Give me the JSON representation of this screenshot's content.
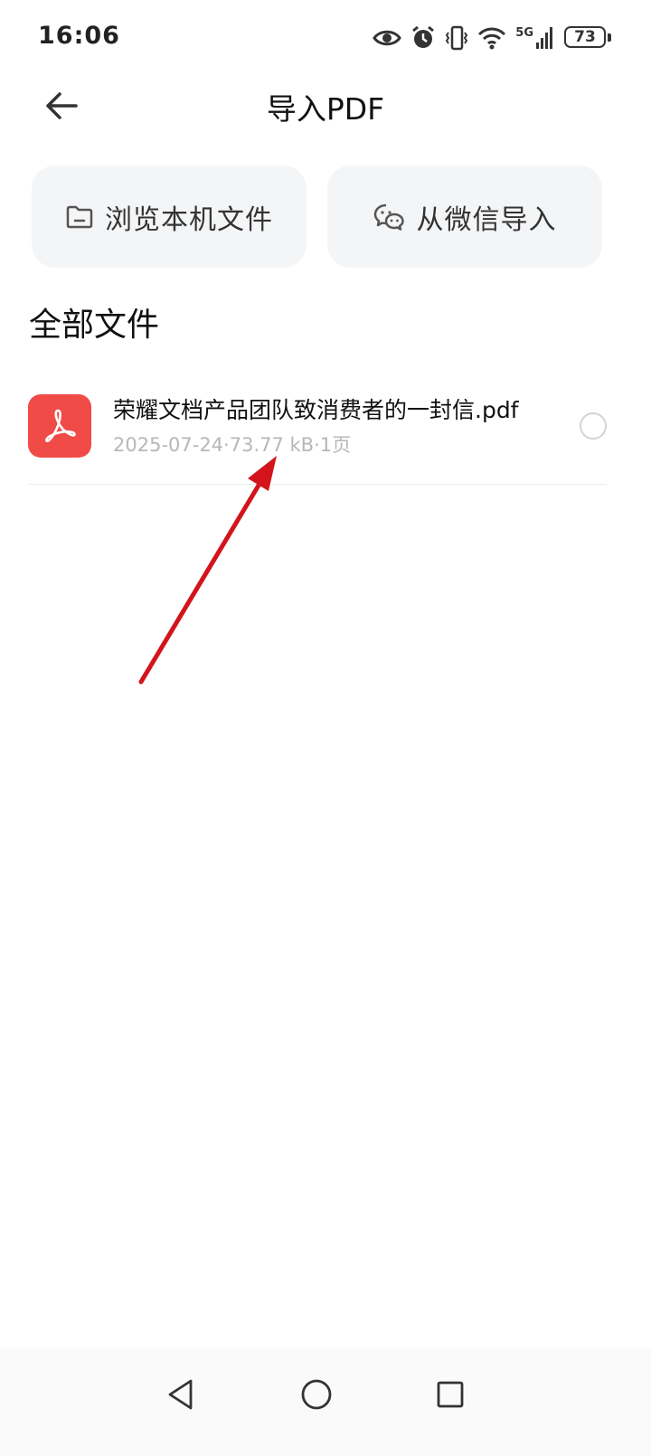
{
  "status_bar": {
    "time": "16:06",
    "network_label": "5G",
    "battery_level": "73",
    "icons": [
      "eye-icon",
      "alarm-icon",
      "vibrate-icon",
      "wifi-icon",
      "signal-icon",
      "battery-icon"
    ]
  },
  "header": {
    "title": "导入PDF",
    "back_icon": "arrow-left-icon"
  },
  "import_options": {
    "local_label": "浏览本机文件",
    "local_icon": "folder-icon",
    "wechat_label": "从微信导入",
    "wechat_icon": "wechat-icon"
  },
  "section": {
    "title": "全部文件"
  },
  "files": [
    {
      "name": "荣耀文档产品团队致消费者的一封信.pdf",
      "meta": "2025-07-24·73.77 kB·1页",
      "icon": "pdf-icon",
      "selected": false
    }
  ],
  "colors": {
    "pdf_red": "#f04b47",
    "button_bg": "#f4f5f7",
    "meta_gray": "#b7b7b7",
    "arrow_red": "#d3141c"
  },
  "nav_bar": {
    "buttons": [
      "nav-back-icon",
      "nav-home-icon",
      "nav-recents-icon"
    ]
  }
}
